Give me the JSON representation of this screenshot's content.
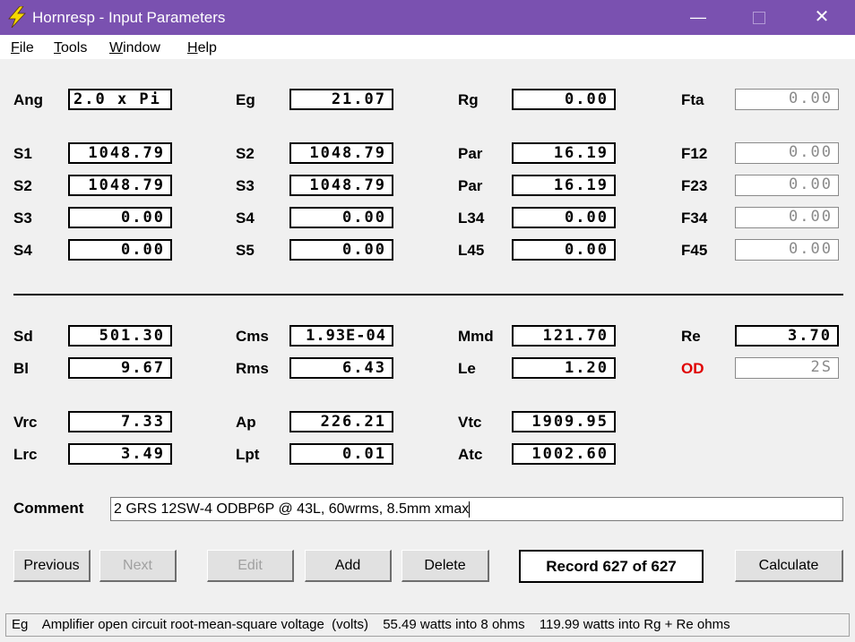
{
  "window": {
    "title": "Hornresp - Input Parameters",
    "title_bar_color": "#7a51b0",
    "icon": "lightning-bolt-icon",
    "controls": {
      "minimize": "—",
      "maximize": "□",
      "close": "✕"
    }
  },
  "menu": [
    "File",
    "Tools",
    "Window",
    "Help"
  ],
  "params": {
    "ang": {
      "label": "Ang",
      "value": "2.0 x Pi"
    },
    "eg": {
      "label": "Eg",
      "value": "21.07"
    },
    "rg": {
      "label": "Rg",
      "value": "0.00"
    },
    "fta": {
      "label": "Fta",
      "value": "0.00"
    },
    "s1": {
      "label": "S1",
      "value": "1048.79"
    },
    "s2a": {
      "label": "S2",
      "value": "1048.79"
    },
    "par1": {
      "label": "Par",
      "value": "16.19"
    },
    "f12": {
      "label": "F12",
      "value": "0.00"
    },
    "s2b": {
      "label": "S2",
      "value": "1048.79"
    },
    "s3a": {
      "label": "S3",
      "value": "1048.79"
    },
    "par2": {
      "label": "Par",
      "value": "16.19"
    },
    "f23": {
      "label": "F23",
      "value": "0.00"
    },
    "s3b": {
      "label": "S3",
      "value": "0.00"
    },
    "s4a": {
      "label": "S4",
      "value": "0.00"
    },
    "l34": {
      "label": "L34",
      "value": "0.00"
    },
    "f34": {
      "label": "F34",
      "value": "0.00"
    },
    "s4b": {
      "label": "S4",
      "value": "0.00"
    },
    "s5": {
      "label": "S5",
      "value": "0.00"
    },
    "l45": {
      "label": "L45",
      "value": "0.00"
    },
    "f45": {
      "label": "F45",
      "value": "0.00"
    },
    "sd": {
      "label": "Sd",
      "value": "501.30"
    },
    "cms": {
      "label": "Cms",
      "value": "1.93E-04"
    },
    "mmd": {
      "label": "Mmd",
      "value": "121.70"
    },
    "re": {
      "label": "Re",
      "value": "3.70"
    },
    "bl": {
      "label": "Bl",
      "value": "9.67"
    },
    "rms": {
      "label": "Rms",
      "value": "6.43"
    },
    "le": {
      "label": "Le",
      "value": "1.20"
    },
    "od": {
      "label": "OD",
      "value": "2S",
      "label_color": "#e00000"
    },
    "vrc": {
      "label": "Vrc",
      "value": "7.33"
    },
    "ap": {
      "label": "Ap",
      "value": "226.21"
    },
    "vtc": {
      "label": "Vtc",
      "value": "1909.95"
    },
    "lrc": {
      "label": "Lrc",
      "value": "3.49"
    },
    "lpt": {
      "label": "Lpt",
      "value": "0.01"
    },
    "atc": {
      "label": "Atc",
      "value": "1002.60"
    }
  },
  "comment": {
    "label": "Comment",
    "value": "2 GRS 12SW-4 ODBP6P @ 43L, 60wrms, 8.5mm xmax"
  },
  "buttons": {
    "previous": "Previous",
    "next": "Next",
    "edit": "Edit",
    "add": "Add",
    "delete": "Delete",
    "calculate": "Calculate"
  },
  "record_text": "Record 627 of 627",
  "status": {
    "param": "Eg",
    "description": "Amplifier open circuit root-mean-square voltage  (volts)",
    "power1": "55.49 watts into 8 ohms",
    "power2": "119.99 watts into Rg + Re ohms"
  }
}
